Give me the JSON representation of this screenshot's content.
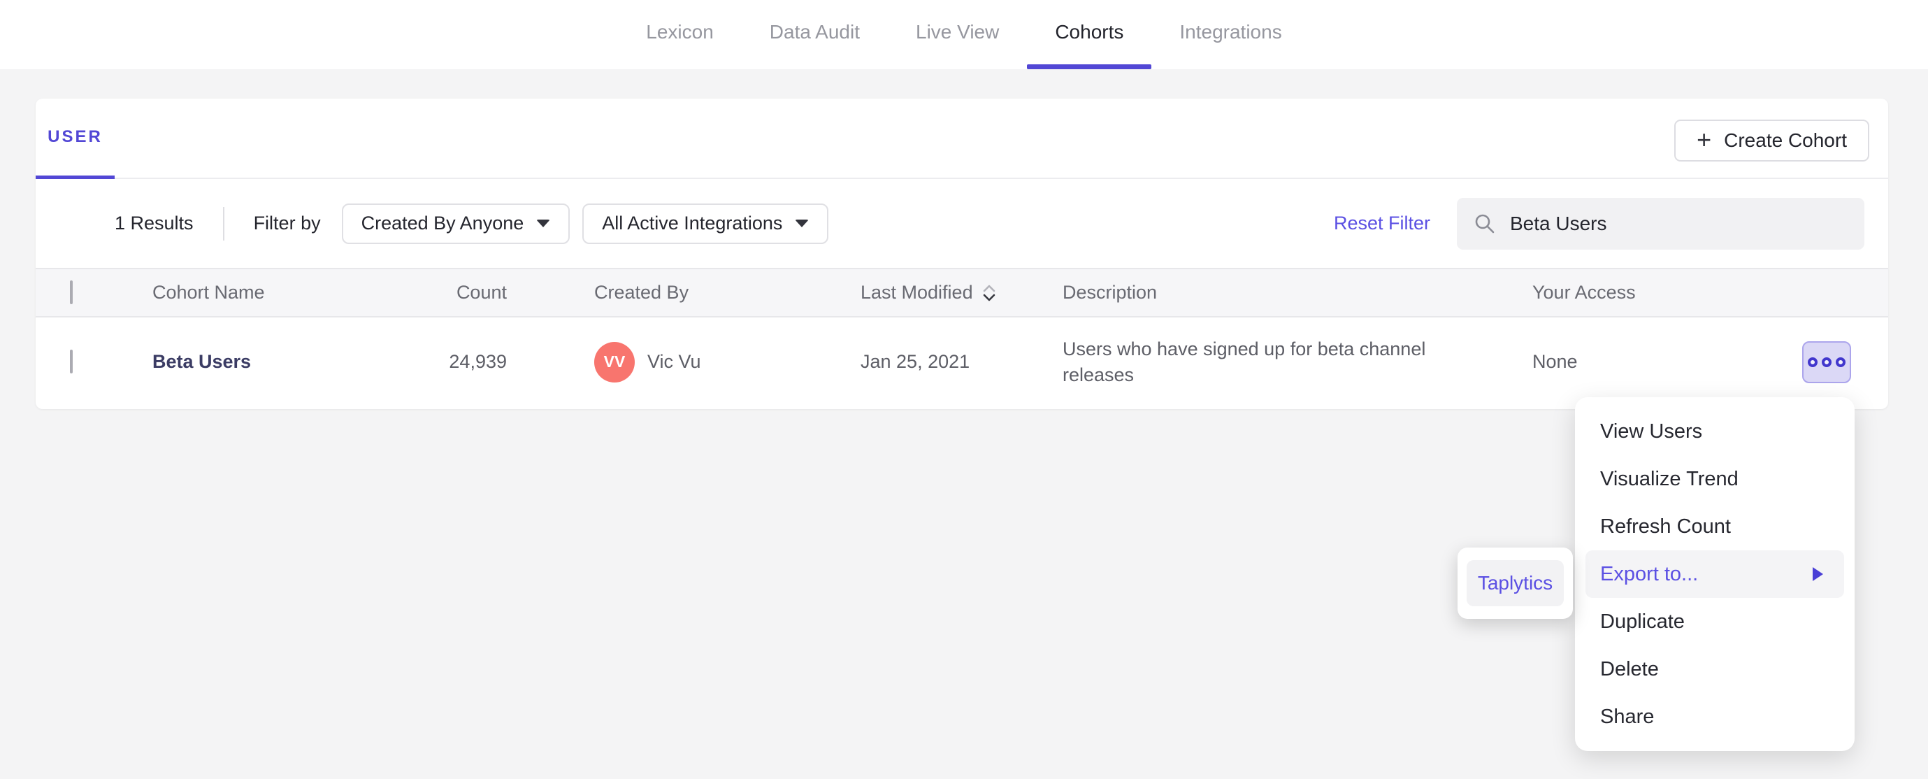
{
  "colors": {
    "accent": "#5247D5",
    "link": "#5B50E3",
    "avatar_bg": "#F8756E"
  },
  "nav": {
    "items": [
      {
        "label": "Lexicon"
      },
      {
        "label": "Data Audit"
      },
      {
        "label": "Live View"
      },
      {
        "label": "Cohorts"
      },
      {
        "label": "Integrations"
      }
    ],
    "active": "Cohorts"
  },
  "cohorts_panel": {
    "tab_label": "USER",
    "create_button": "Create Cohort",
    "plus_icon": "+",
    "filter_bar": {
      "results_count": "1 Results",
      "filter_by_label": "Filter by",
      "created_by_dropdown": "Created By Anyone",
      "integrations_dropdown": "All Active Integrations",
      "reset_filter": "Reset Filter",
      "search_value": "Beta Users"
    },
    "table": {
      "headers": {
        "name": "Cohort Name",
        "count": "Count",
        "created_by": "Created By",
        "last_modified": "Last Modified",
        "description": "Description",
        "access": "Your Access"
      },
      "rows": [
        {
          "name": "Beta Users",
          "count": "24,939",
          "avatar_initials": "VV",
          "created_by": "Vic Vu",
          "last_modified": "Jan 25, 2021",
          "description": "Users who have signed up for beta channel releases",
          "access": "None"
        }
      ]
    }
  },
  "context_menu": {
    "items": [
      {
        "label": "View Users"
      },
      {
        "label": "Visualize Trend"
      },
      {
        "label": "Refresh Count"
      },
      {
        "label": "Export to..."
      },
      {
        "label": "Duplicate"
      },
      {
        "label": "Delete"
      },
      {
        "label": "Share"
      }
    ],
    "highlighted": "Export to..."
  },
  "export_submenu": {
    "items": [
      {
        "label": "Taplytics"
      }
    ]
  }
}
